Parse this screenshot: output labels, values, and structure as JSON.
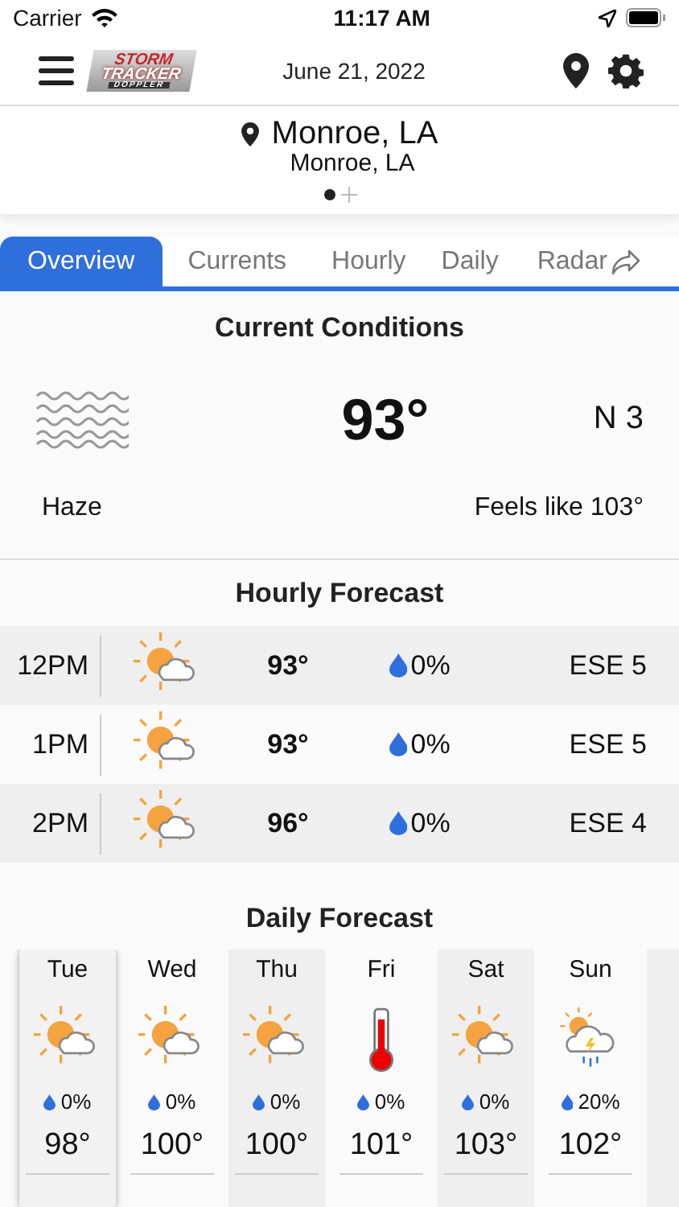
{
  "status_bar": {
    "carrier": "Carrier",
    "time": "11:17 AM"
  },
  "header": {
    "logo": {
      "line_1": "STORM",
      "line_2": "TRACKER",
      "line_3": "DOPPLER"
    },
    "date": "June 21, 2022"
  },
  "location": {
    "name": "Monroe, LA",
    "subtitle": "Monroe, LA",
    "pages": [
      {
        "selected": true
      }
    ]
  },
  "tabs": [
    {
      "label": "Overview",
      "selected": true
    },
    {
      "label": "Currents",
      "selected": false
    },
    {
      "label": "Hourly",
      "selected": false
    },
    {
      "label": "Daily",
      "selected": false
    },
    {
      "label": "Radar",
      "selected": false
    }
  ],
  "current_conditions": {
    "title": "Current Conditions",
    "temperature": "93°",
    "wind": "N 3",
    "condition": "Haze",
    "feels_like": "Feels like 103°"
  },
  "hourly_forecast": {
    "title": "Hourly Forecast",
    "rows": [
      {
        "time": "12PM",
        "temperature": "93°",
        "precipitation": "0%",
        "wind": "ESE 5"
      },
      {
        "time": "1PM",
        "temperature": "93°",
        "precipitation": "0%",
        "wind": "ESE 5"
      },
      {
        "time": "2PM",
        "temperature": "96°",
        "precipitation": "0%",
        "wind": "ESE 4"
      }
    ]
  },
  "daily_forecast": {
    "title": "Daily Forecast",
    "days": [
      {
        "day": "Tue",
        "kind": "partly-sunny",
        "precipitation": "0%",
        "high": "98°",
        "selected": true
      },
      {
        "day": "Wed",
        "kind": "partly-sunny",
        "precipitation": "0%",
        "high": "100°",
        "selected": false
      },
      {
        "day": "Thu",
        "kind": "partly-sunny",
        "precipitation": "0%",
        "high": "100°",
        "selected": false
      },
      {
        "day": "Fri",
        "kind": "hot",
        "precipitation": "0%",
        "high": "101°",
        "selected": false
      },
      {
        "day": "Sat",
        "kind": "partly-sunny",
        "precipitation": "0%",
        "high": "103°",
        "selected": false
      },
      {
        "day": "Sun",
        "kind": "storm",
        "precipitation": "20%",
        "high": "102°",
        "selected": false
      }
    ]
  }
}
